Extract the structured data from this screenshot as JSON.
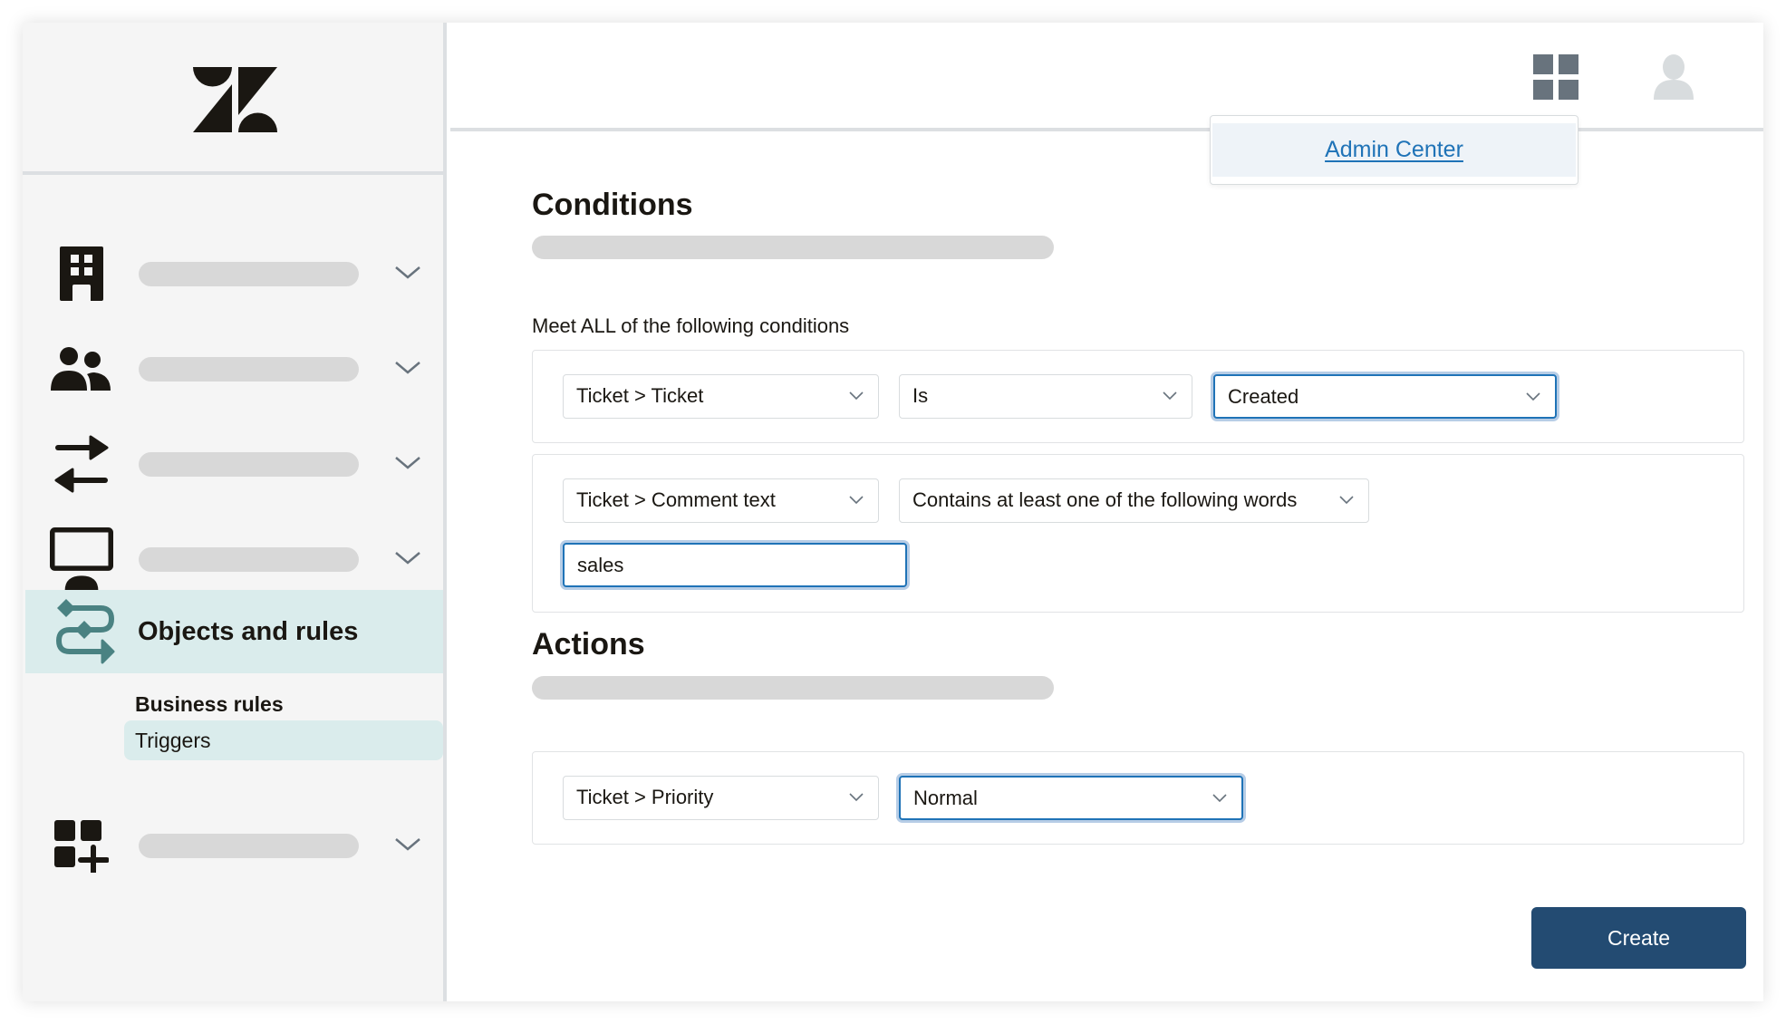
{
  "sidebar": {
    "logo": "zendesk-logo",
    "items": [
      {
        "icon": "building-icon",
        "label": "",
        "expandable": true
      },
      {
        "icon": "users-icon",
        "label": "",
        "expandable": true
      },
      {
        "icon": "channels-arrows-icon",
        "label": "",
        "expandable": true
      },
      {
        "icon": "workspaces-monitor-icon",
        "label": "",
        "expandable": true
      },
      {
        "icon": "objects-rules-icon",
        "label": "Objects and rules",
        "active": true,
        "subitems": [
          {
            "label": "Business rules",
            "type": "group-heading"
          },
          {
            "label": "Triggers",
            "active": true
          }
        ]
      },
      {
        "icon": "apps-add-icon",
        "label": "",
        "expandable": true
      }
    ]
  },
  "header": {
    "products_icon": "grid-icon",
    "user_icon": "avatar-icon",
    "popover": {
      "link_label": "Admin Center"
    }
  },
  "conditions": {
    "title": "Conditions",
    "meet_label": "Meet ALL of the following conditions",
    "rows": [
      {
        "field": "Ticket > Ticket",
        "operator": "Is",
        "value": "Created"
      },
      {
        "field": "Ticket > Comment text",
        "operator": "Contains at least one of the following words",
        "input_value": "sales"
      }
    ]
  },
  "actions": {
    "title": "Actions",
    "rows": [
      {
        "field": "Ticket > Priority",
        "value": "Normal"
      }
    ]
  },
  "footer": {
    "create_label": "Create"
  },
  "colors": {
    "accent": "#1f73b7",
    "primary_button": "#234b72",
    "active_nav_bg": "#daecec",
    "active_icon": "#4a8282",
    "sidebar_bg": "#f5f5f5",
    "skeleton": "#d8d8d8"
  }
}
